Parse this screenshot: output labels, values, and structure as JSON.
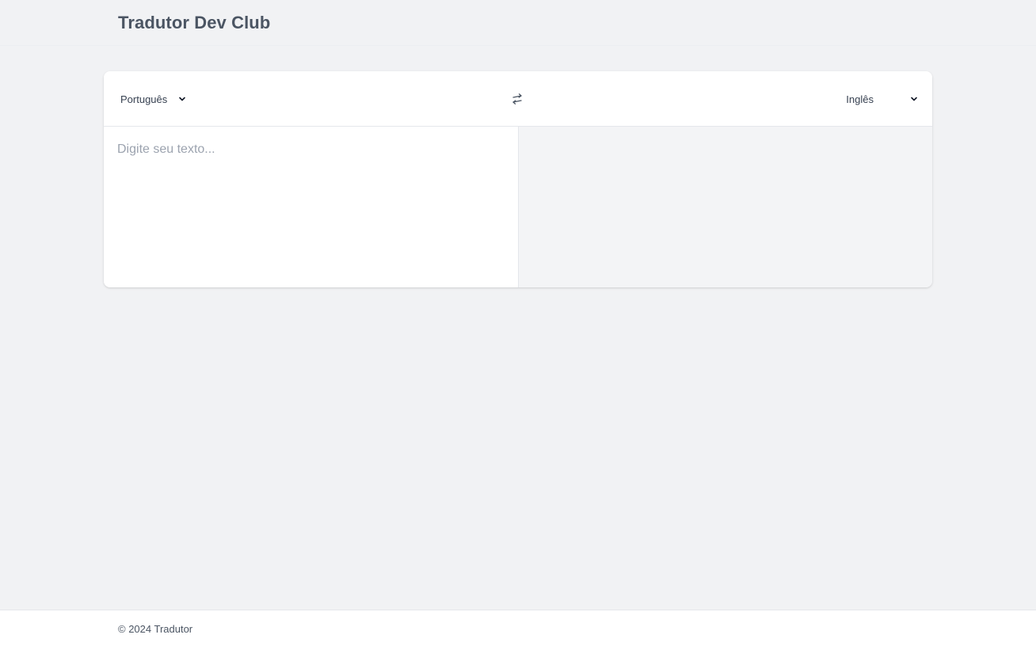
{
  "header": {
    "title": "Tradutor Dev Club"
  },
  "translator": {
    "source_language": "Português",
    "target_language": "Inglês",
    "input": {
      "value": "",
      "placeholder": "Digite seu texto..."
    },
    "output": {
      "value": ""
    },
    "icons": {
      "swap": "swap-arrows-icon",
      "dropdown": "chevron-down-icon"
    }
  },
  "footer": {
    "text": "© 2024 Tradutor"
  },
  "colors": {
    "page_background": "#f1f2f4",
    "card_background": "#ffffff",
    "output_background": "#f3f4f6",
    "title_text": "#4b5563",
    "placeholder_text": "#9ca3af"
  }
}
